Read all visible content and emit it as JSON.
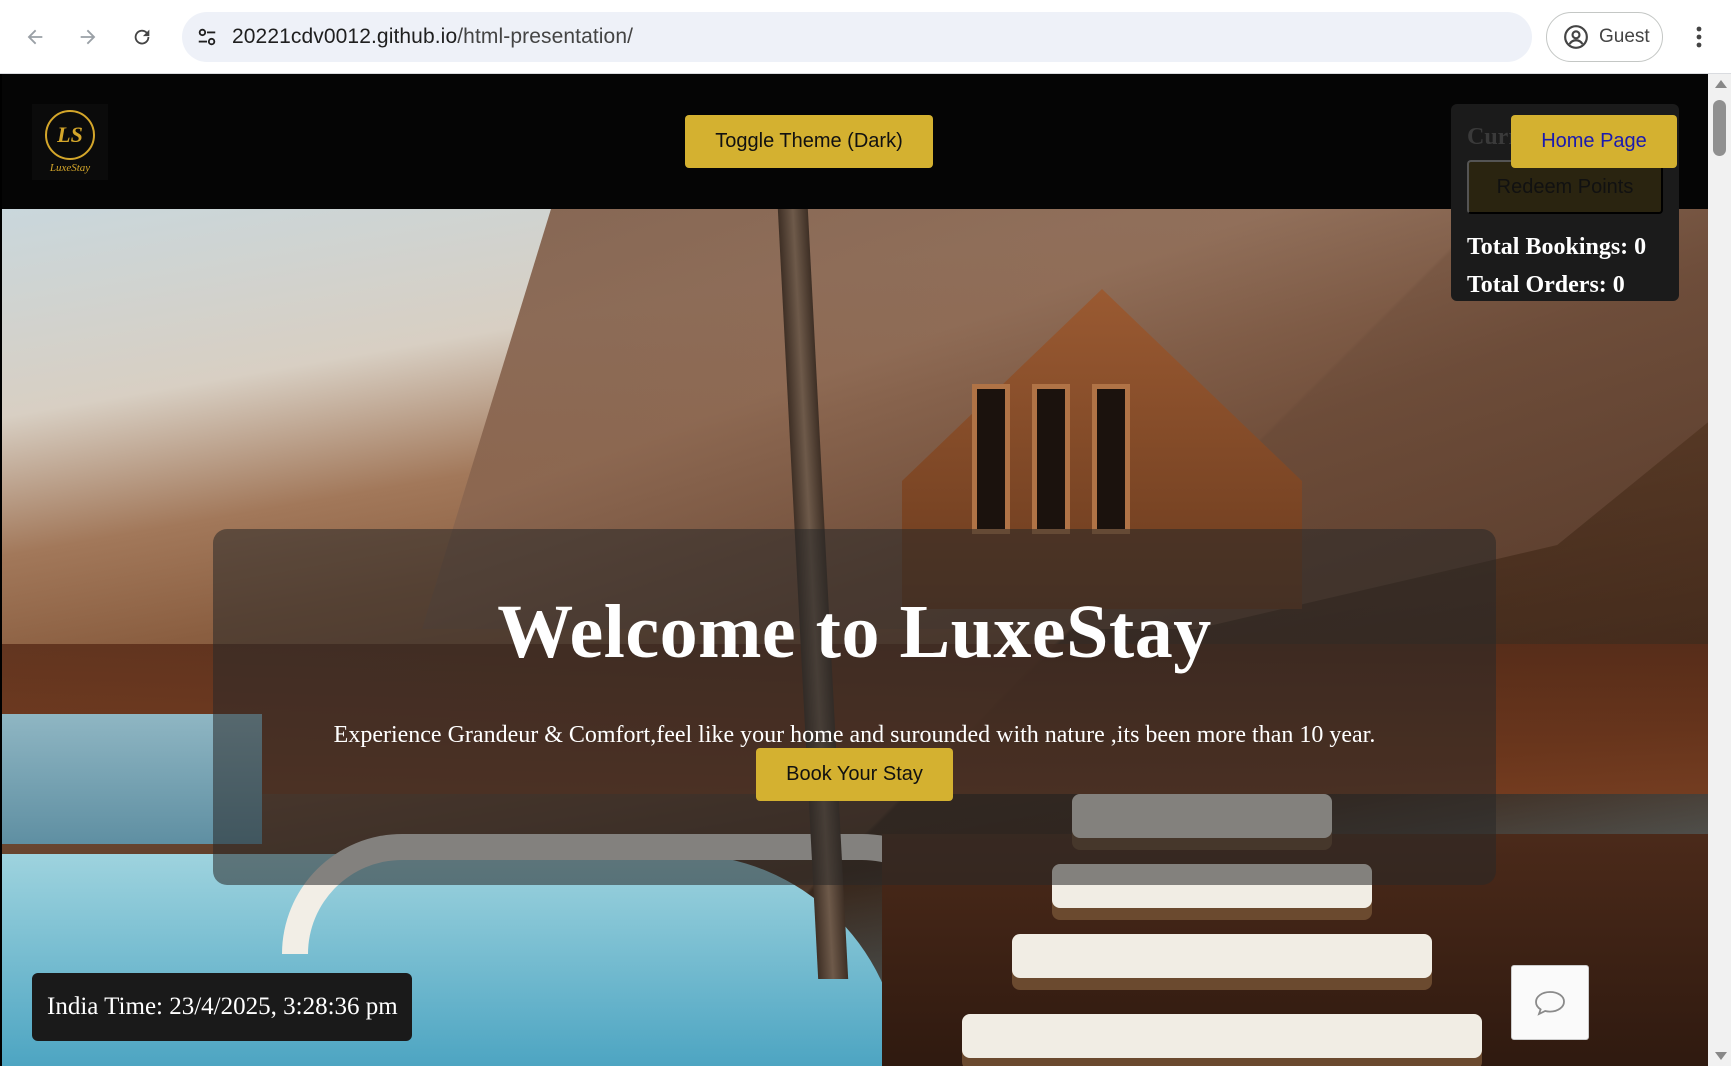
{
  "browser": {
    "url_host": "20221cdv0012.github.io",
    "url_path": "/html-presentation/",
    "profile_label": "Guest"
  },
  "header": {
    "logo_monogram": "LS",
    "logo_text": "LuxeStay",
    "toggle_theme_label": "Toggle Theme (Dark)",
    "home_label": "Home Page"
  },
  "points_panel": {
    "heading_partial": "Curr",
    "redeem_label": "Redeem Points",
    "total_bookings": "Total Bookings: 0",
    "total_orders": "Total Orders: 0"
  },
  "hero": {
    "title": "Welcome to LuxeStay",
    "subtitle": "Experience Grandeur & Comfort,feel like your home and surounded with nature ,its been more than 10 year.",
    "book_label": "Book Your Stay"
  },
  "clock": {
    "text": "India Time: 23/4/2025, 3:28:36 pm"
  },
  "colors": {
    "gold": "#d4b130",
    "header_bg": "#050505",
    "home_text": "#1a1ab0"
  }
}
